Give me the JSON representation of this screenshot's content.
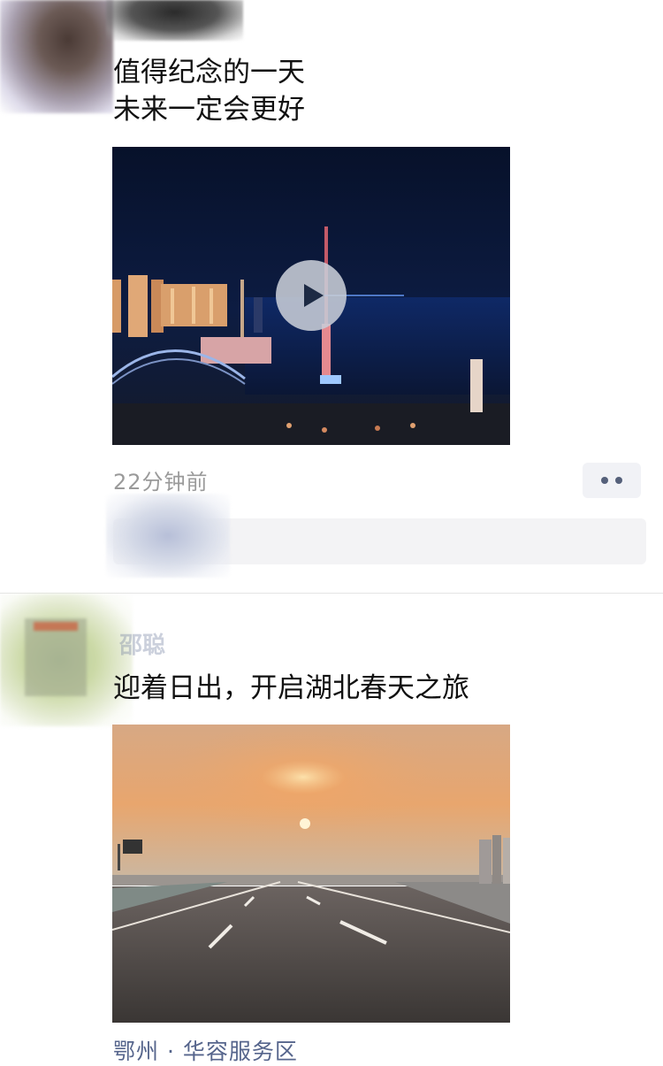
{
  "posts": [
    {
      "text_lines": [
        "值得纪念的一天",
        "未来一定会更好"
      ],
      "timestamp": "22分钟前"
    },
    {
      "name": "邵聪",
      "text": "迎着日出，开启湖北春天之旅",
      "location": "鄂州 · 华容服务区"
    }
  ],
  "icons": {
    "play": "play-icon",
    "more": "more-dots-icon"
  },
  "colors": {
    "link": "#56658c",
    "timestamp": "#9a9a9a",
    "more_button_bg": "#f1f2f6",
    "like_bar_bg": "#f3f3f5"
  }
}
